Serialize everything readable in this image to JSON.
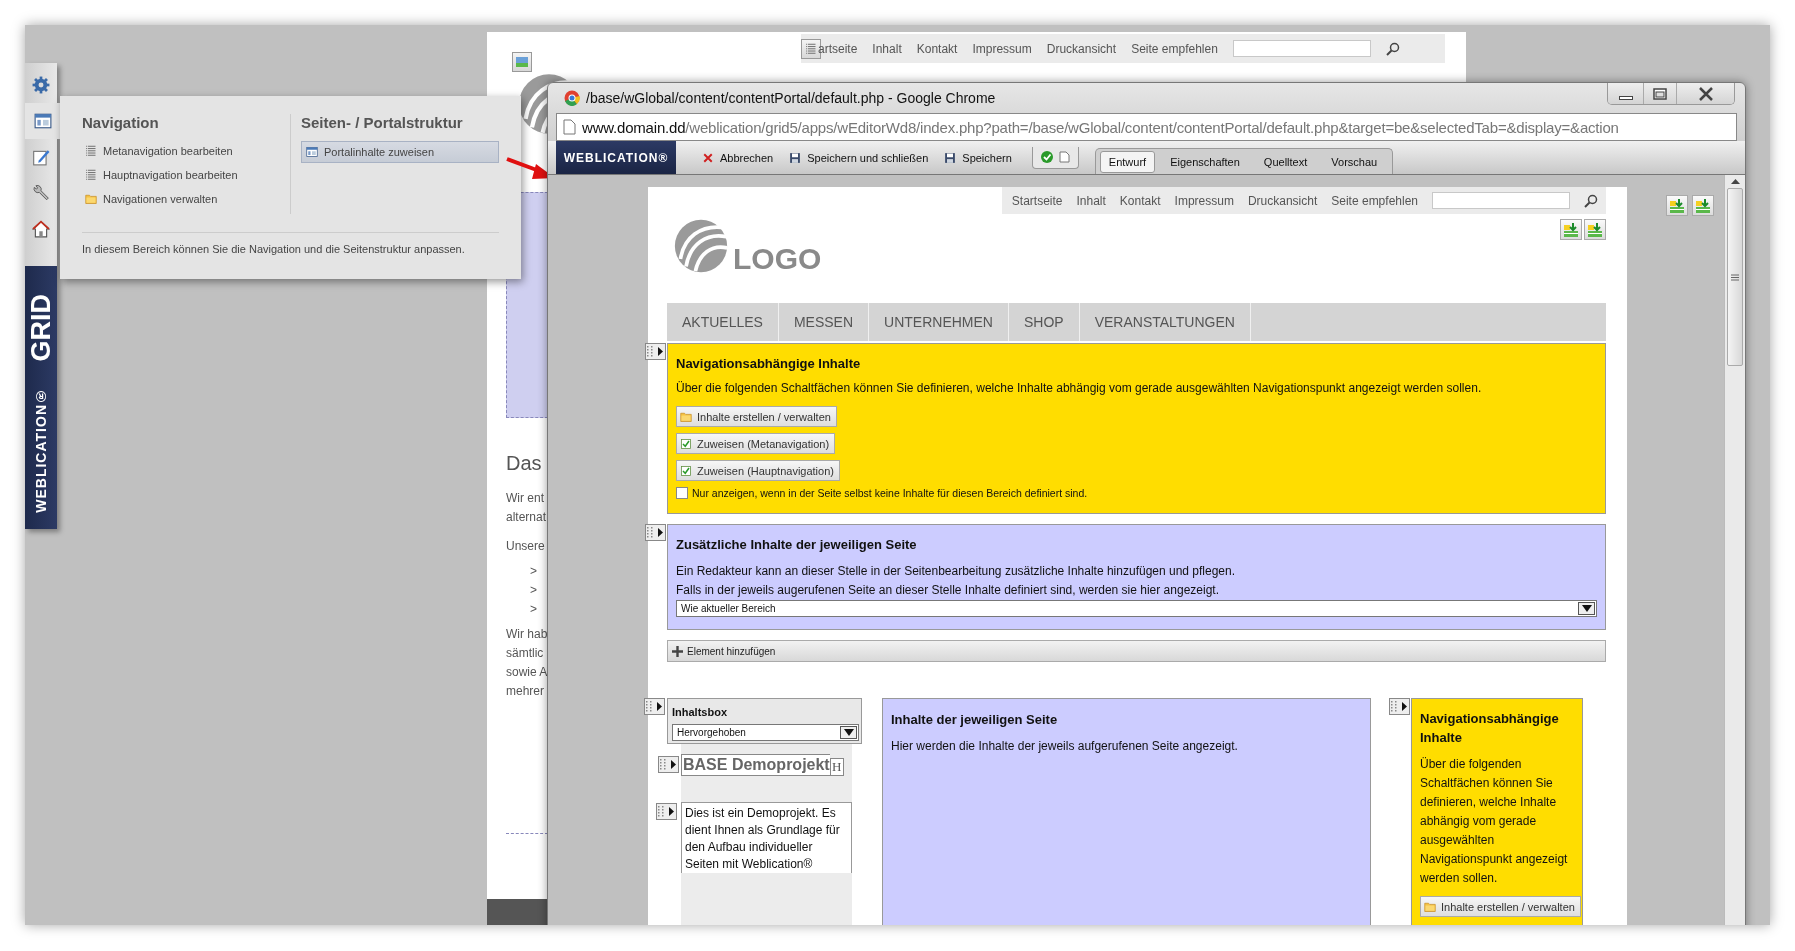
{
  "sidebar": {
    "items": [
      {
        "kind": "gear",
        "selected": false
      },
      {
        "kind": "layout",
        "selected": true
      },
      {
        "kind": "edit",
        "selected": false
      },
      {
        "kind": "wrench",
        "selected": false
      },
      {
        "kind": "home",
        "selected": false
      }
    ],
    "logo": "GRID",
    "brand": "WEBLICATION",
    "brand_mark": "®"
  },
  "popup": {
    "sections": [
      {
        "title": "Navigation",
        "items": [
          {
            "label": "Metanavigation bearbeiten",
            "kind": "list",
            "selected": false
          },
          {
            "label": "Hauptnavigation bearbeiten",
            "kind": "list",
            "selected": false
          },
          {
            "label": "Navigationen verwalten",
            "kind": "folder",
            "selected": false
          }
        ]
      },
      {
        "title": "Seiten- / Portalstruktur",
        "items": [
          {
            "label": "Portalinhalte zuweisen",
            "kind": "layout",
            "selected": true
          }
        ]
      }
    ],
    "footer": "In diesem Bereich können Sie die Navigation und die Seitenstruktur anpassen."
  },
  "background_page": {
    "top_links": [
      "artseite",
      "Inhalt",
      "Kontakt",
      "Impressum",
      "Druckansicht",
      "Seite empfehlen"
    ],
    "heading": "Das",
    "fragments": [
      "Wir ent",
      "alternat",
      "Unsere"
    ],
    "bullets": [
      ">",
      ">",
      ">"
    ],
    "fragments_2": [
      "Wir hab",
      "sämtlic",
      "sowie A",
      "mehrer"
    ]
  },
  "browser": {
    "title": "/base/wGlobal/content/contentPortal/default.php - Google Chrome",
    "url_host": "www.domain.dd",
    "url_path": "/weblication/grid5/apps/wEditorWd8/index.php?path=/base/wGlobal/content/contentPortal/default.php&target=be&selectedTab=&display=&action",
    "toolbar": {
      "brand": "WEBLICATION",
      "brand_mark": "®",
      "buttons": [
        {
          "label": "Abbrechen",
          "kind": "cancel"
        },
        {
          "label": "Speichern und schließen",
          "kind": "save"
        },
        {
          "label": "Speichern",
          "kind": "save"
        }
      ],
      "tabs": [
        {
          "label": "Entwurf",
          "selected": true
        },
        {
          "label": "Eigenschaften",
          "selected": false
        },
        {
          "label": "Quelltext",
          "selected": false
        },
        {
          "label": "Vorschau",
          "selected": false
        }
      ]
    },
    "page": {
      "top_links": [
        "Startseite",
        "Inhalt",
        "Kontakt",
        "Impressum",
        "Druckansicht",
        "Seite empfehlen"
      ],
      "logo": "LOGO",
      "menu": [
        "AKTUELLES",
        "MESSEN",
        "UNTERNEHMEN",
        "SHOP",
        "VERANSTALTUNGEN"
      ],
      "nav_area": {
        "title": "Navigationsabhängige Inhalte",
        "text": "Über die folgenden Schaltfächen können Sie definieren, welche Inhalte abhängig vom gerade ausgewählten Navigationspunkt angezeigt werden sollen.",
        "buttons": [
          {
            "label": "Inhalte erstellen / verwalten",
            "kind": "folder"
          },
          {
            "label": "Zuweisen (Metanavigation)",
            "kind": "assign"
          },
          {
            "label": "Zuweisen (Hauptnavigation)",
            "kind": "assign"
          }
        ],
        "checkbox": {
          "label": "Nur anzeigen, wenn in der Seite selbst keine Inhalte für diesen Bereich definiert sind.",
          "checked": false
        }
      },
      "extra_area": {
        "title": "Zusätzliche Inhalte der jeweiligen Seite",
        "lines": [
          "Ein Redakteur kann an dieser Stelle in der Seitenbearbeitung zusätzliche Inhalte hinzufügen und pflegen.",
          "Falls in der jeweils augerufenen Seite an dieser Stelle Inhalte definiert sind, werden sie hier angezeigt."
        ],
        "select": "Wie aktueller Bereich"
      },
      "add_element": "Element hinzufügen",
      "left_column": {
        "title": "Inhaltsbox",
        "select": "Hervorgehoben",
        "heading": "BASE Demoprojekt",
        "heading_tag": "H",
        "text": "Dies ist ein Demoprojekt. Es dient Ihnen als Grundlage für den Aufbau individueller Seiten mit Weblication®"
      },
      "main_column": {
        "title": "Inhalte der jeweiligen Seite",
        "text": "Hier werden die Inhalte der jeweils aufgerufenen Seite angezeigt."
      },
      "right_column": {
        "title": "Navigationsabhängige Inhalte",
        "text": "Über die folgenden Schaltfächen können Sie definieren, welche Inhalte abhängig vom gerade ausgewählten Navigationspunkt angezeigt werden sollen.",
        "button": {
          "label": "Inhalte erstellen / verwalten",
          "kind": "folder"
        }
      }
    }
  }
}
